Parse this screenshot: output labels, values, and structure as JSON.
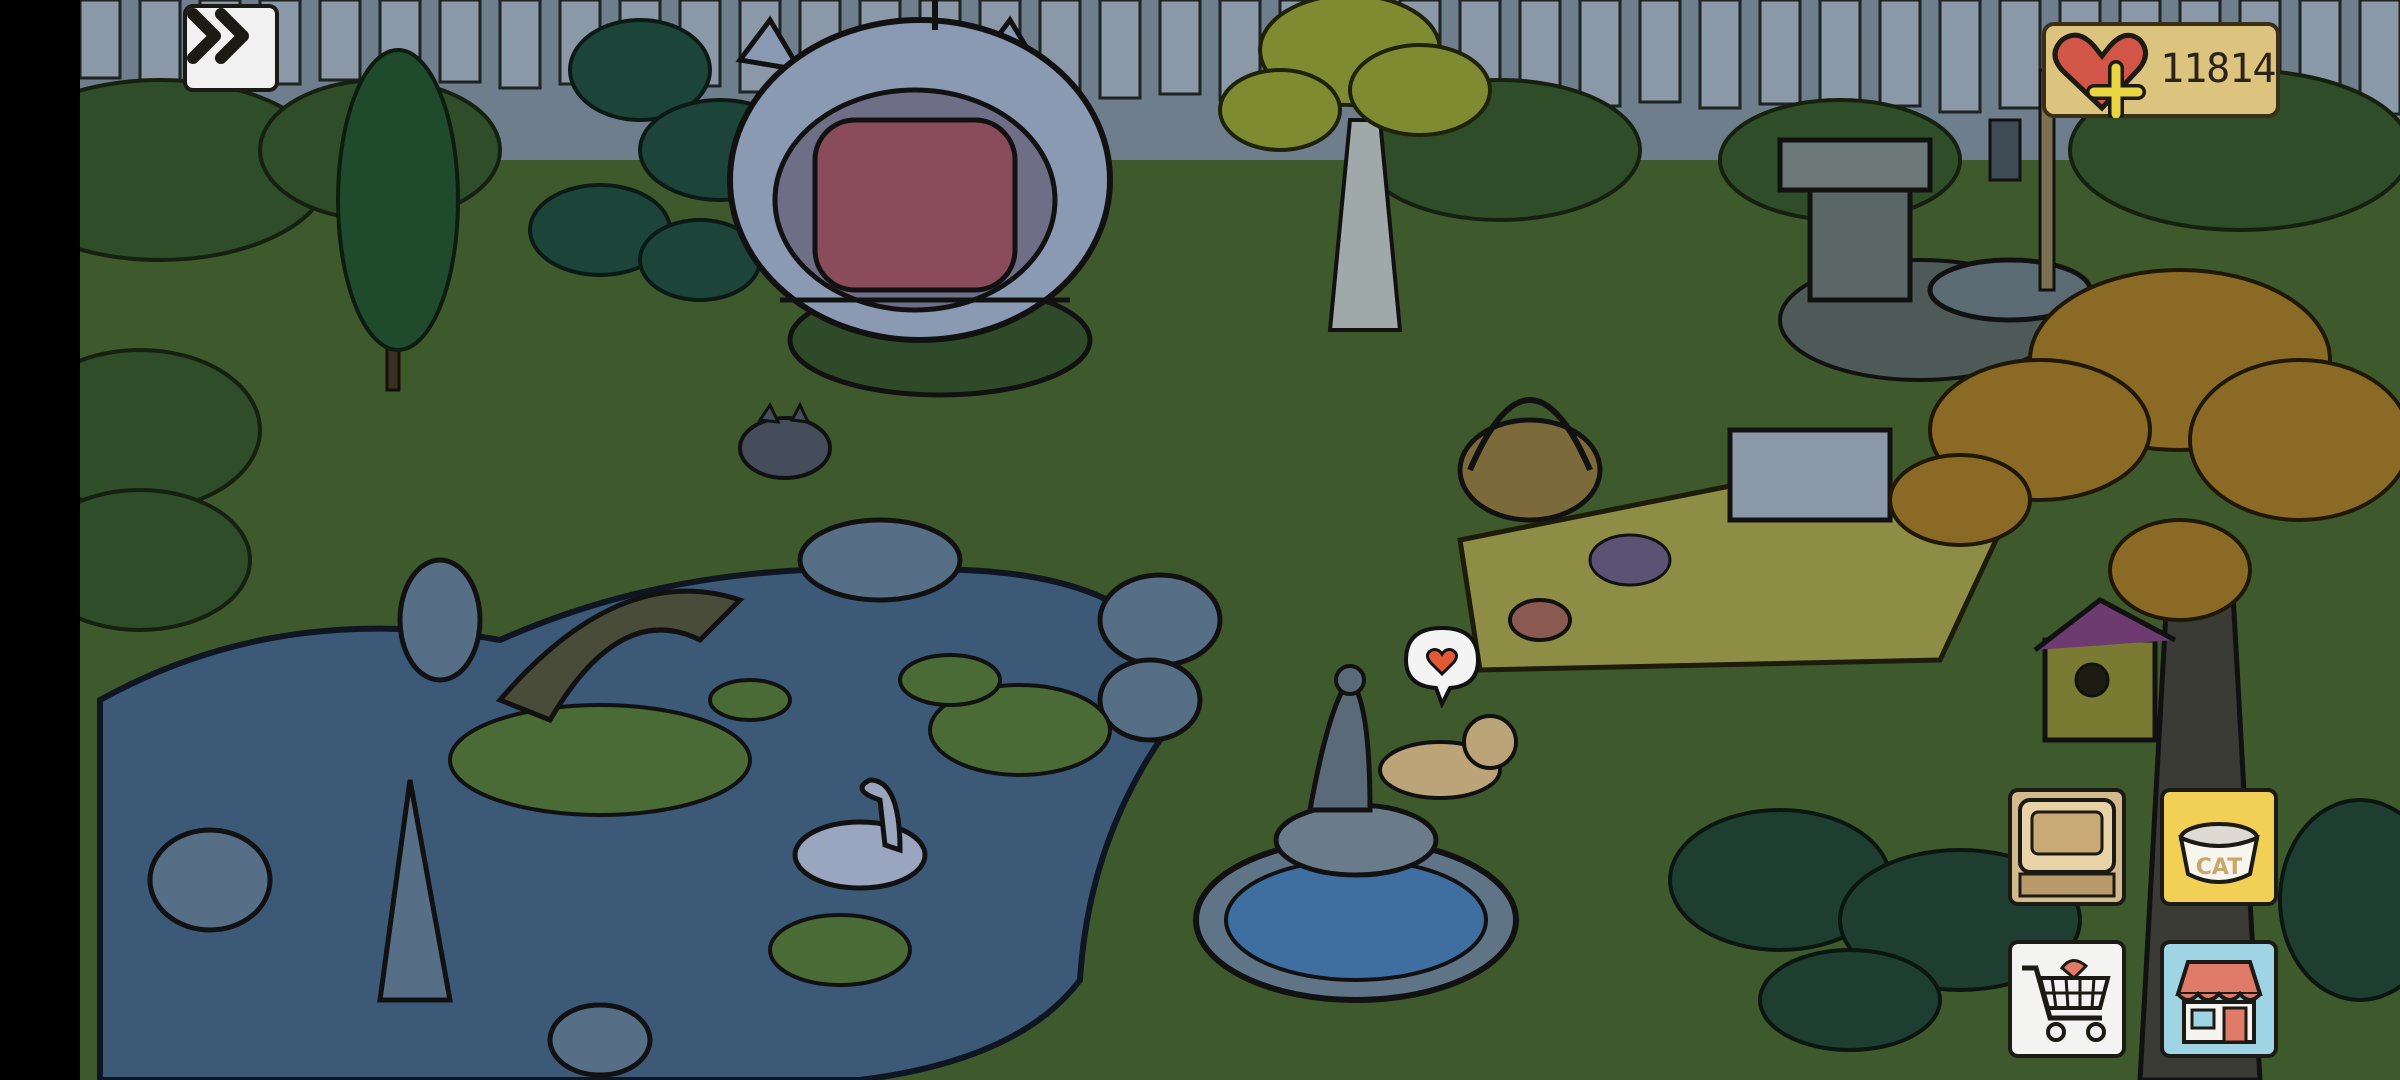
{
  "hud": {
    "hearts": "11814",
    "food_bowl_label": "CAT"
  },
  "icons": {
    "fast_forward": "double-chevron-right-icon",
    "hearts": "heart-plus-icon",
    "goodies": "goodies-box-icon",
    "food": "food-bowl-icon",
    "shop": "shopping-cart-icon",
    "yard": "house-icon"
  },
  "colors": {
    "grass": "#3e5a2d",
    "pond": "#3c5a78",
    "fence": "#8795a4",
    "gold_plate": "#ddc47e"
  }
}
